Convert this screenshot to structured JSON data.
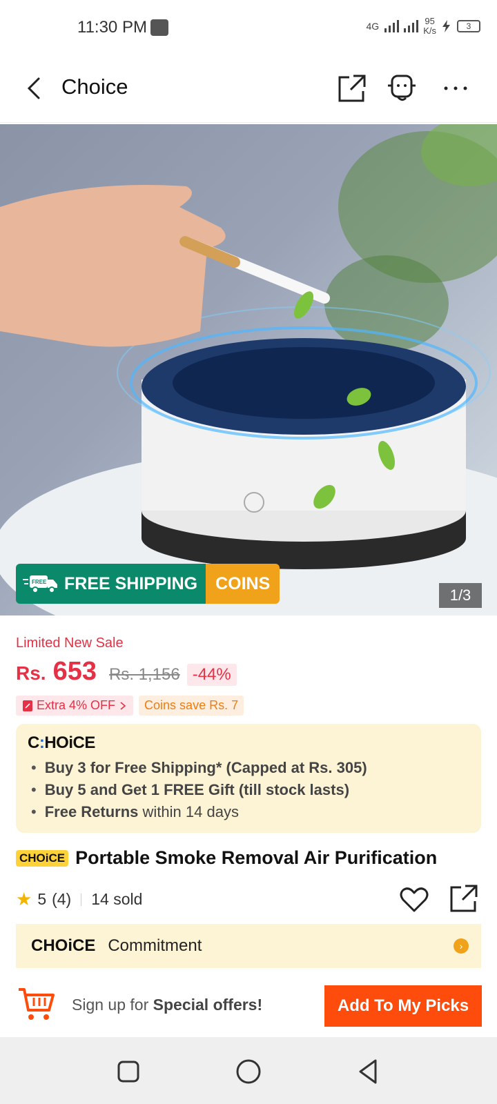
{
  "status_bar": {
    "time": "11:30 PM",
    "network_type": "4G",
    "speed_value": "95",
    "speed_unit": "K/s",
    "battery": "3"
  },
  "header": {
    "title": "Choice",
    "icons": [
      "back-arrow-icon",
      "share-icon",
      "customer-service-icon",
      "more-icon"
    ]
  },
  "hero": {
    "image_desc_icon": "product-photo",
    "free_shipping_label": "FREE SHIPPING",
    "free_badge_label": "FREE",
    "coins_label": "COINS",
    "counter": "1/3"
  },
  "price": {
    "sale_label": "Limited New Sale",
    "currency": "Rs.",
    "current": "653",
    "original": "Rs. 1,156",
    "discount": "-44%",
    "extra_off": "Extra 4% OFF",
    "coins_save": "Coins save Rs. 7"
  },
  "choice_box": {
    "logo_pre": "C",
    "logo_dots": ":",
    "logo_post": "HOiCE",
    "items": [
      {
        "bold": "Buy 3 for  Free Shipping* (Capped at Rs. 305)",
        "rest": ""
      },
      {
        "bold": "Buy 5 and Get 1 FREE Gift (till stock lasts)",
        "rest": ""
      },
      {
        "bold": "Free Returns",
        "rest": " within 14 days"
      }
    ]
  },
  "product": {
    "badge": "CHOiCE",
    "name": "Portable Smoke Removal Air Purification",
    "rating": "5",
    "reviews": "(4)",
    "sold": "14 sold"
  },
  "commitment": {
    "logo": "CHOiCE",
    "text": "Commitment"
  },
  "action_bar": {
    "signup_prefix": "Sign up for ",
    "signup_bold": "Special offers!",
    "add_button": "Add To My Picks"
  },
  "colors": {
    "accent_red": "#e53145",
    "button_orange": "#fe4c0d",
    "shipping_green": "#0b8a6b",
    "coins_orange": "#f0a21a",
    "choice_bg": "#fdf3d5"
  }
}
